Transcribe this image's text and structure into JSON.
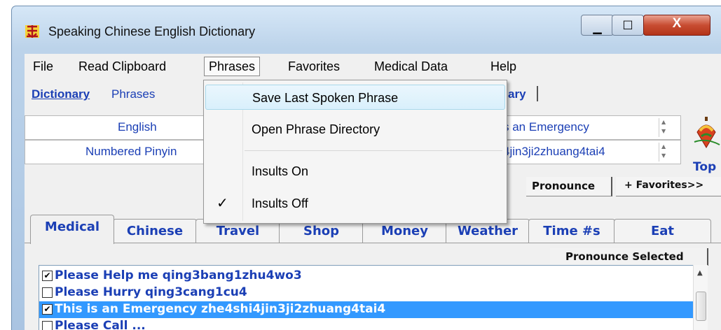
{
  "window": {
    "title": "Speaking Chinese English Dictionary",
    "minimize_glyph": "▁",
    "maximize_glyph": "□",
    "close_glyph": "X"
  },
  "menubar": {
    "file": "File",
    "read_clipboard": "Read Clipboard",
    "phrases": "Phrases",
    "favorites": "Favorites",
    "medical_data": "Medical Data",
    "help": "Help"
  },
  "phrases_menu": {
    "save_last": "Save Last Spoken Phrase",
    "open_dir": "Open Phrase Directory",
    "insults_on": "Insults On",
    "insults_off": "Insults Off",
    "insults_off_checked": true,
    "check_glyph": "✓"
  },
  "top_tabs": {
    "dictionary": "Dictionary",
    "phrases": "Phrases",
    "partial": "ary"
  },
  "fields": {
    "english_label": "English",
    "english_value": "s an Emergency",
    "pinyin_label": "Numbered Pinyin",
    "pinyin_value": "4jin3ji2zhuang4tai4"
  },
  "top_label": "Top",
  "buttons": {
    "pronounce": "Pronounce",
    "favorites": "+ Favorites>>",
    "pronounce_selected": "Pronounce Selected"
  },
  "phrase_tabs": [
    "Medical",
    "Chinese",
    "Travel",
    "Shop",
    "Money",
    "Weather",
    "Time #s",
    "Eat"
  ],
  "phrase_list": [
    {
      "checked": true,
      "text": "Please Help me qing3bang1zhu4wo3",
      "selected": false
    },
    {
      "checked": false,
      "text": "Please Hurry qing3cang1cu4",
      "selected": false
    },
    {
      "checked": true,
      "text": "This is an Emergency zhe4shi4jin3ji2zhuang4tai4",
      "selected": true
    },
    {
      "checked": false,
      "text": "Please Call ... ",
      "selected": false
    }
  ],
  "colors": {
    "link_blue": "#1b3fb5",
    "highlight": "#3399ff",
    "close_red": "#c84d32"
  }
}
